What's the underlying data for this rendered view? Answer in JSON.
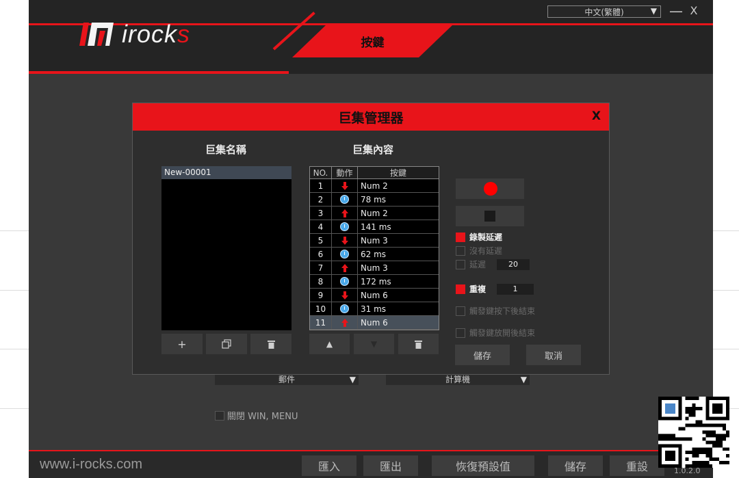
{
  "window": {
    "language": "中文(繁體)",
    "minimize_glyph": "—",
    "close_glyph": "X"
  },
  "brand": {
    "logo_text_main": "irock",
    "logo_text_accent": "s",
    "accent_color": "#e8141a",
    "website": "www.i-rocks.com"
  },
  "header": {
    "active_tab": "按鍵"
  },
  "background": {
    "dropdown1": "郵件",
    "dropdown2": "計算機",
    "checkbox_label": "關閉 WIN, MENU"
  },
  "footer": {
    "buttons": [
      "匯入",
      "匯出",
      "恢復預設值",
      "儲存",
      "重設"
    ],
    "version": "1.0.2.0"
  },
  "dialog": {
    "title": "巨集管理器",
    "close": "X",
    "macro_names_title": "巨集名稱",
    "macro_content_title": "巨集內容",
    "macros": [
      "New-00001"
    ],
    "table_headers": [
      "NO.",
      "動作",
      "按鍵"
    ],
    "rows": [
      {
        "no": "1",
        "action": "key-down",
        "key": "Num 2"
      },
      {
        "no": "2",
        "action": "delay",
        "key": "78 ms"
      },
      {
        "no": "3",
        "action": "key-up",
        "key": "Num 2"
      },
      {
        "no": "4",
        "action": "delay",
        "key": "141 ms"
      },
      {
        "no": "5",
        "action": "key-down",
        "key": "Num 3"
      },
      {
        "no": "6",
        "action": "delay",
        "key": "62 ms"
      },
      {
        "no": "7",
        "action": "key-up",
        "key": "Num 3"
      },
      {
        "no": "8",
        "action": "delay",
        "key": "172 ms"
      },
      {
        "no": "9",
        "action": "key-down",
        "key": "Num 6"
      },
      {
        "no": "10",
        "action": "delay",
        "key": "31 ms"
      },
      {
        "no": "11",
        "action": "key-up",
        "key": "Num 6"
      }
    ],
    "selected_row": "11",
    "options": {
      "record_delay": "錄製延遲",
      "no_delay": "沒有延遲",
      "delay": "延遲",
      "delay_value": "20",
      "repeat": "重複",
      "repeat_value": "1",
      "end_on_trigger_press": "觸發鍵按下後結束",
      "end_on_trigger_release": "觸發鍵放開後結束"
    },
    "save": "儲存",
    "cancel": "取消"
  }
}
